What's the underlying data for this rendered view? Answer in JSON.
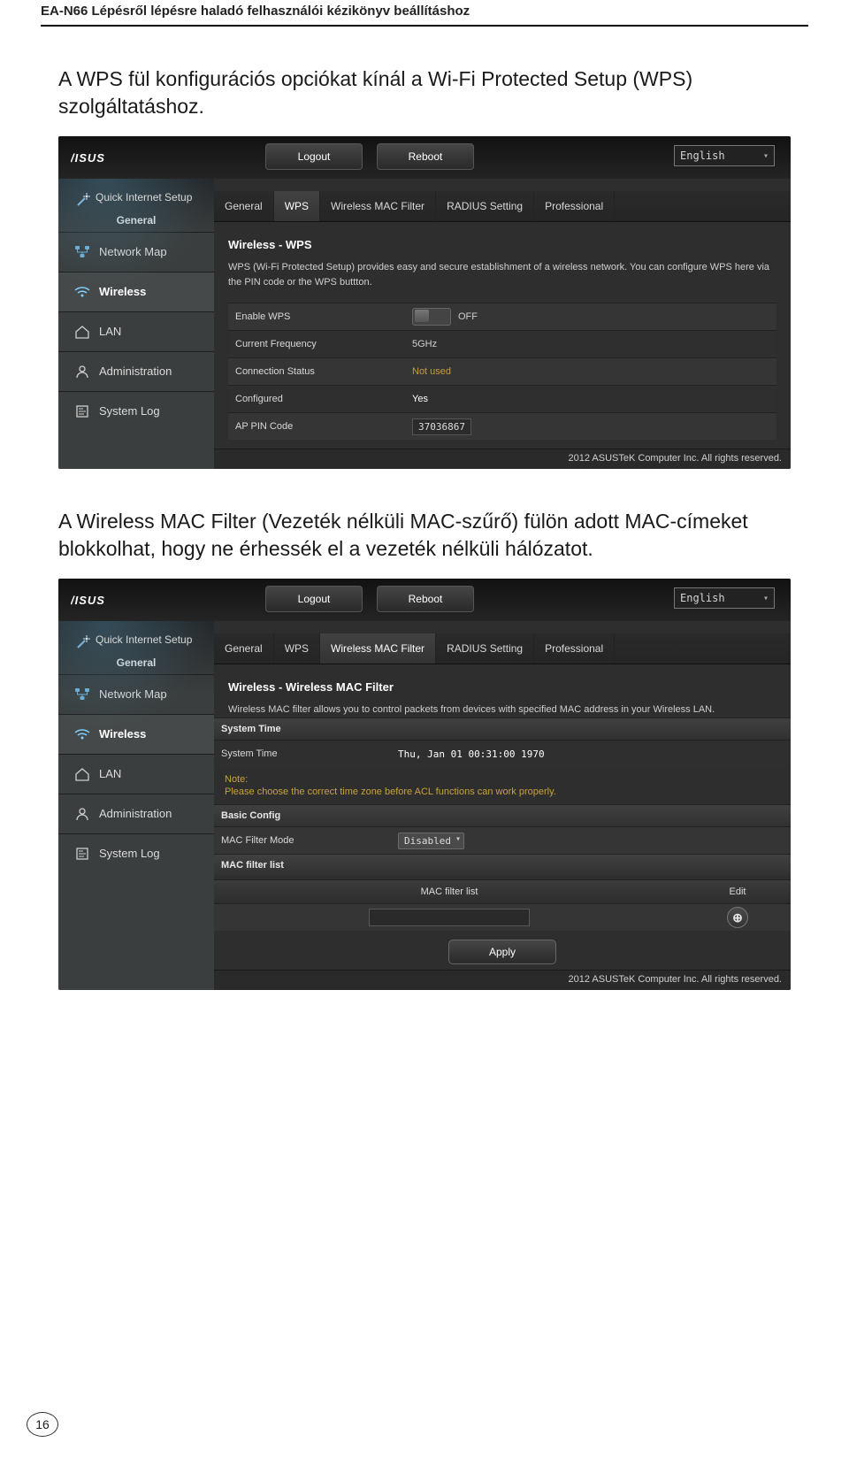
{
  "header": {
    "title": "EA-N66 Lépésről lépésre haladó felhasználói kézikönyv beállításhoz"
  },
  "paragraphs": {
    "p1": "A WPS fül konfigurációs opciókat kínál a Wi-Fi Protected Setup (WPS) szolgáltatáshoz.",
    "p2": "A Wireless MAC Filter (Vezeték nélküli MAC-szűrő) fülön adott MAC-címeket blokkolhat, hogy ne érhessék el a vezeték nélküli hálózatot."
  },
  "common": {
    "logout": "Logout",
    "reboot": "Reboot",
    "language": "English",
    "quick_setup": "Quick Internet Setup",
    "section_general": "General",
    "nav": {
      "network_map": "Network Map",
      "wireless": "Wireless",
      "lan": "LAN",
      "administration": "Administration",
      "system_log": "System Log"
    },
    "tabs": {
      "general": "General",
      "wps": "WPS",
      "mac_filter": "Wireless MAC Filter",
      "radius": "RADIUS Setting",
      "professional": "Professional"
    },
    "footer": "2012 ASUSTeK Computer Inc. All rights reserved."
  },
  "shot1": {
    "panel_title": "Wireless - WPS",
    "panel_desc": "WPS (Wi-Fi Protected Setup) provides easy and secure establishment of a wireless network. You can configure WPS here via the PIN code or the WPS buttton.",
    "rows": {
      "enable_wps_k": "Enable WPS",
      "enable_wps_v": "OFF",
      "freq_k": "Current Frequency",
      "freq_v": "5GHz",
      "conn_k": "Connection Status",
      "conn_v": "Not used",
      "conf_k": "Configured",
      "conf_v": "Yes",
      "pin_k": "AP PIN Code",
      "pin_v": "37036867"
    }
  },
  "shot2": {
    "panel_title": "Wireless - Wireless MAC Filter",
    "panel_desc": "Wireless MAC filter allows you to control packets from devices with specified MAC address in your Wireless LAN.",
    "system_time_head": "System Time",
    "system_time_k": "System Time",
    "system_time_v": "Thu, Jan 01 00:31:00 1970",
    "note_label": "Note:",
    "note_text": "Please choose the correct time zone before ACL functions can work properly.",
    "basic_config_head": "Basic Config",
    "mac_mode_k": "MAC Filter Mode",
    "mac_mode_v": "Disabled",
    "mac_list_head": "MAC filter list",
    "mac_list_col1": "MAC filter list",
    "mac_list_col2": "Edit",
    "apply": "Apply"
  },
  "page_number": "16"
}
